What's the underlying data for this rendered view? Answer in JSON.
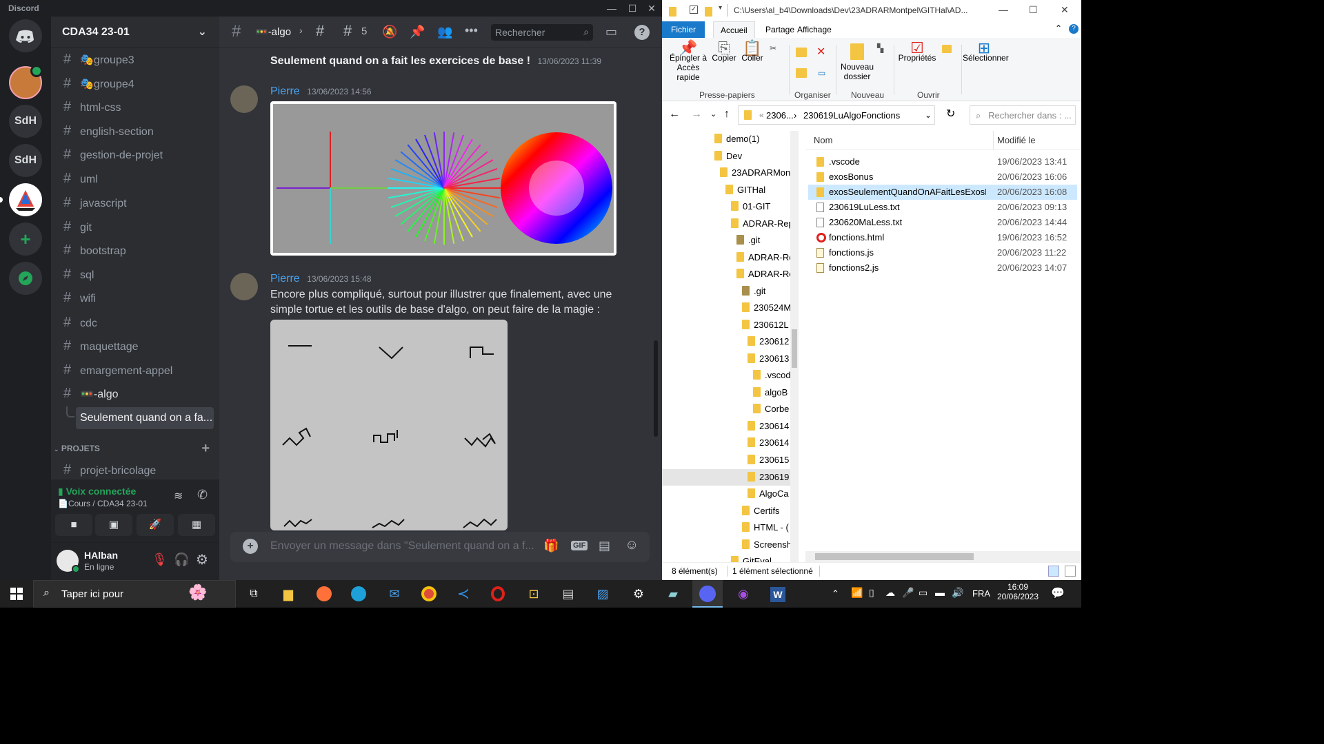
{
  "discord": {
    "brand": "Discord",
    "window_controls": {
      "minimize": "—",
      "maximize": "☐",
      "close": "✕"
    },
    "guilds": [
      "SdH",
      "SdH"
    ],
    "server_name": "CDA34 23-01",
    "channels": [
      {
        "name": "groupe3",
        "emoji": true
      },
      {
        "name": "groupe4",
        "emoji": true
      },
      {
        "name": "html-css"
      },
      {
        "name": "english-section"
      },
      {
        "name": "gestion-de-projet"
      },
      {
        "name": "uml"
      },
      {
        "name": "javascript"
      },
      {
        "name": "git"
      },
      {
        "name": "bootstrap"
      },
      {
        "name": "sql"
      },
      {
        "name": "wifi"
      },
      {
        "name": "cdc"
      },
      {
        "name": "maquettage"
      },
      {
        "name": "emargement-appel"
      },
      {
        "name": "-algo",
        "emoji": true
      }
    ],
    "thread_name": "Seulement quand on a fa...",
    "category": "PROJETS",
    "category_channel": "projet-bricolage",
    "voice_status": "Voix connectée",
    "voice_location": "Cours / CDA34 23-01",
    "username": "HAlban",
    "user_status": "En ligne",
    "header": {
      "channel": "-algo",
      "thread_count": "5",
      "search_placeholder": "Rechercher"
    },
    "messages": [
      {
        "bold_text": "Seulement quand on a fait les exercices de base !",
        "timestamp": "13/06/2023 11:39"
      },
      {
        "author": "Pierre",
        "timestamp": "13/06/2023 14:56"
      },
      {
        "author": "Pierre",
        "timestamp": "13/06/2023 15:48",
        "text": "Encore plus compliqué, surtout pour illustrer que finalement, avec une simple tortue et les outils de base d'algo, on peut faire de la magie :"
      }
    ],
    "composer_placeholder": "Envoyer un message dans \"Seulement quand on a f...",
    "composer_gif": "GIF"
  },
  "explorer": {
    "title_path": "C:\\Users\\al_b4\\Downloads\\Dev\\23ADRARMontpel\\GITHal\\AD...",
    "tabs": [
      "Fichier",
      "Accueil",
      "Partage",
      "Affichage"
    ],
    "ribbon": {
      "pin": "Épingler à Accès rapide",
      "copy": "Copier",
      "paste": "Coller",
      "new_folder": "Nouveau dossier",
      "properties": "Propriétés",
      "select": "Sélectionner",
      "groups": [
        "Presse-papiers",
        "Organiser",
        "Nouveau",
        "Ouvrir"
      ]
    },
    "address": {
      "crumb1": "2306...",
      "crumb2": "230619LuAlgoFonctions",
      "search_placeholder": "Rechercher dans : ..."
    },
    "tree": [
      "demo(1)",
      "Dev",
      "23ADRARMont",
      "GITHal",
      "01-GIT",
      "ADRAR-Rep",
      ".git",
      "ADRAR-Re",
      "ADRAR-Re",
      ".git",
      "230524M",
      "230612L",
      "230612",
      "230613",
      ".vscod",
      "algoB",
      "Corbe",
      "230614",
      "230614",
      "230615",
      "230619",
      "AlgoCa",
      "Certifs",
      "HTML - (",
      "Screensh",
      "GitEval"
    ],
    "columns": {
      "name": "Nom",
      "modified": "Modifié le"
    },
    "files": [
      {
        "name": ".vscode",
        "type": "folder",
        "date": "19/06/2023 13:41"
      },
      {
        "name": "exosBonus",
        "type": "folder",
        "date": "20/06/2023 16:06"
      },
      {
        "name": "exosSeulementQuandOnAFaitLesExosDe...",
        "type": "folder",
        "date": "20/06/2023 16:08",
        "selected": true
      },
      {
        "name": "230619LuLess.txt",
        "type": "txt",
        "date": "20/06/2023 09:13"
      },
      {
        "name": "230620MaLess.txt",
        "type": "txt",
        "date": "20/06/2023 14:44"
      },
      {
        "name": "fonctions.html",
        "type": "html",
        "date": "19/06/2023 16:52"
      },
      {
        "name": "fonctions.js",
        "type": "js",
        "date": "20/06/2023 11:22"
      },
      {
        "name": "fonctions2.js",
        "type": "js",
        "date": "20/06/2023 14:07"
      }
    ],
    "status": {
      "count": "8 élément(s)",
      "selection": "1 élément sélectionné"
    }
  },
  "taskbar": {
    "search_placeholder": "Taper ici pour",
    "lang": "FRA",
    "time": "16:09",
    "date": "20/06/2023"
  }
}
